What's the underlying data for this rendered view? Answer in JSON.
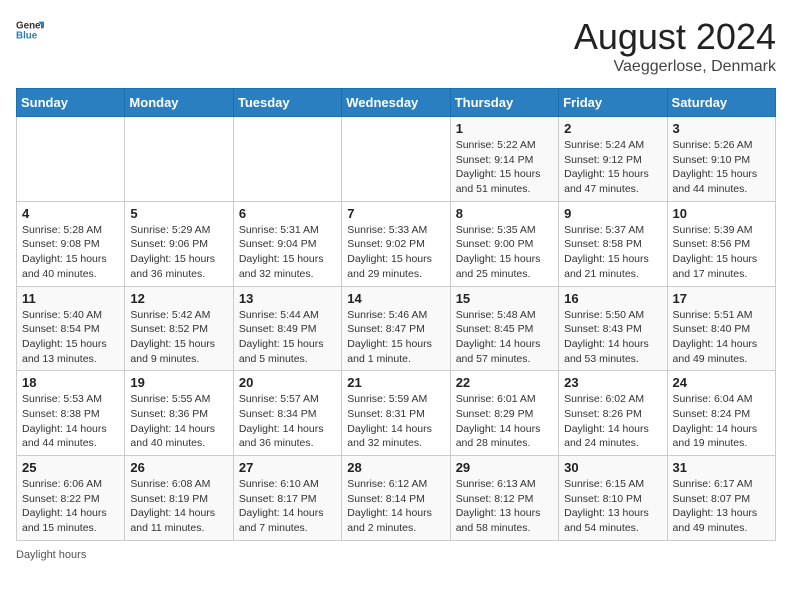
{
  "header": {
    "logo_general": "General",
    "logo_blue": "Blue",
    "main_title": "August 2024",
    "subtitle": "Vaeggerlose, Denmark"
  },
  "days_of_week": [
    "Sunday",
    "Monday",
    "Tuesday",
    "Wednesday",
    "Thursday",
    "Friday",
    "Saturday"
  ],
  "weeks": [
    [
      {
        "day": "",
        "info": ""
      },
      {
        "day": "",
        "info": ""
      },
      {
        "day": "",
        "info": ""
      },
      {
        "day": "",
        "info": ""
      },
      {
        "day": "1",
        "info": "Sunrise: 5:22 AM\nSunset: 9:14 PM\nDaylight: 15 hours and 51 minutes."
      },
      {
        "day": "2",
        "info": "Sunrise: 5:24 AM\nSunset: 9:12 PM\nDaylight: 15 hours and 47 minutes."
      },
      {
        "day": "3",
        "info": "Sunrise: 5:26 AM\nSunset: 9:10 PM\nDaylight: 15 hours and 44 minutes."
      }
    ],
    [
      {
        "day": "4",
        "info": "Sunrise: 5:28 AM\nSunset: 9:08 PM\nDaylight: 15 hours and 40 minutes."
      },
      {
        "day": "5",
        "info": "Sunrise: 5:29 AM\nSunset: 9:06 PM\nDaylight: 15 hours and 36 minutes."
      },
      {
        "day": "6",
        "info": "Sunrise: 5:31 AM\nSunset: 9:04 PM\nDaylight: 15 hours and 32 minutes."
      },
      {
        "day": "7",
        "info": "Sunrise: 5:33 AM\nSunset: 9:02 PM\nDaylight: 15 hours and 29 minutes."
      },
      {
        "day": "8",
        "info": "Sunrise: 5:35 AM\nSunset: 9:00 PM\nDaylight: 15 hours and 25 minutes."
      },
      {
        "day": "9",
        "info": "Sunrise: 5:37 AM\nSunset: 8:58 PM\nDaylight: 15 hours and 21 minutes."
      },
      {
        "day": "10",
        "info": "Sunrise: 5:39 AM\nSunset: 8:56 PM\nDaylight: 15 hours and 17 minutes."
      }
    ],
    [
      {
        "day": "11",
        "info": "Sunrise: 5:40 AM\nSunset: 8:54 PM\nDaylight: 15 hours and 13 minutes."
      },
      {
        "day": "12",
        "info": "Sunrise: 5:42 AM\nSunset: 8:52 PM\nDaylight: 15 hours and 9 minutes."
      },
      {
        "day": "13",
        "info": "Sunrise: 5:44 AM\nSunset: 8:49 PM\nDaylight: 15 hours and 5 minutes."
      },
      {
        "day": "14",
        "info": "Sunrise: 5:46 AM\nSunset: 8:47 PM\nDaylight: 15 hours and 1 minute."
      },
      {
        "day": "15",
        "info": "Sunrise: 5:48 AM\nSunset: 8:45 PM\nDaylight: 14 hours and 57 minutes."
      },
      {
        "day": "16",
        "info": "Sunrise: 5:50 AM\nSunset: 8:43 PM\nDaylight: 14 hours and 53 minutes."
      },
      {
        "day": "17",
        "info": "Sunrise: 5:51 AM\nSunset: 8:40 PM\nDaylight: 14 hours and 49 minutes."
      }
    ],
    [
      {
        "day": "18",
        "info": "Sunrise: 5:53 AM\nSunset: 8:38 PM\nDaylight: 14 hours and 44 minutes."
      },
      {
        "day": "19",
        "info": "Sunrise: 5:55 AM\nSunset: 8:36 PM\nDaylight: 14 hours and 40 minutes."
      },
      {
        "day": "20",
        "info": "Sunrise: 5:57 AM\nSunset: 8:34 PM\nDaylight: 14 hours and 36 minutes."
      },
      {
        "day": "21",
        "info": "Sunrise: 5:59 AM\nSunset: 8:31 PM\nDaylight: 14 hours and 32 minutes."
      },
      {
        "day": "22",
        "info": "Sunrise: 6:01 AM\nSunset: 8:29 PM\nDaylight: 14 hours and 28 minutes."
      },
      {
        "day": "23",
        "info": "Sunrise: 6:02 AM\nSunset: 8:26 PM\nDaylight: 14 hours and 24 minutes."
      },
      {
        "day": "24",
        "info": "Sunrise: 6:04 AM\nSunset: 8:24 PM\nDaylight: 14 hours and 19 minutes."
      }
    ],
    [
      {
        "day": "25",
        "info": "Sunrise: 6:06 AM\nSunset: 8:22 PM\nDaylight: 14 hours and 15 minutes."
      },
      {
        "day": "26",
        "info": "Sunrise: 6:08 AM\nSunset: 8:19 PM\nDaylight: 14 hours and 11 minutes."
      },
      {
        "day": "27",
        "info": "Sunrise: 6:10 AM\nSunset: 8:17 PM\nDaylight: 14 hours and 7 minutes."
      },
      {
        "day": "28",
        "info": "Sunrise: 6:12 AM\nSunset: 8:14 PM\nDaylight: 14 hours and 2 minutes."
      },
      {
        "day": "29",
        "info": "Sunrise: 6:13 AM\nSunset: 8:12 PM\nDaylight: 13 hours and 58 minutes."
      },
      {
        "day": "30",
        "info": "Sunrise: 6:15 AM\nSunset: 8:10 PM\nDaylight: 13 hours and 54 minutes."
      },
      {
        "day": "31",
        "info": "Sunrise: 6:17 AM\nSunset: 8:07 PM\nDaylight: 13 hours and 49 minutes."
      }
    ]
  ],
  "footer": {
    "daylight_label": "Daylight hours"
  }
}
